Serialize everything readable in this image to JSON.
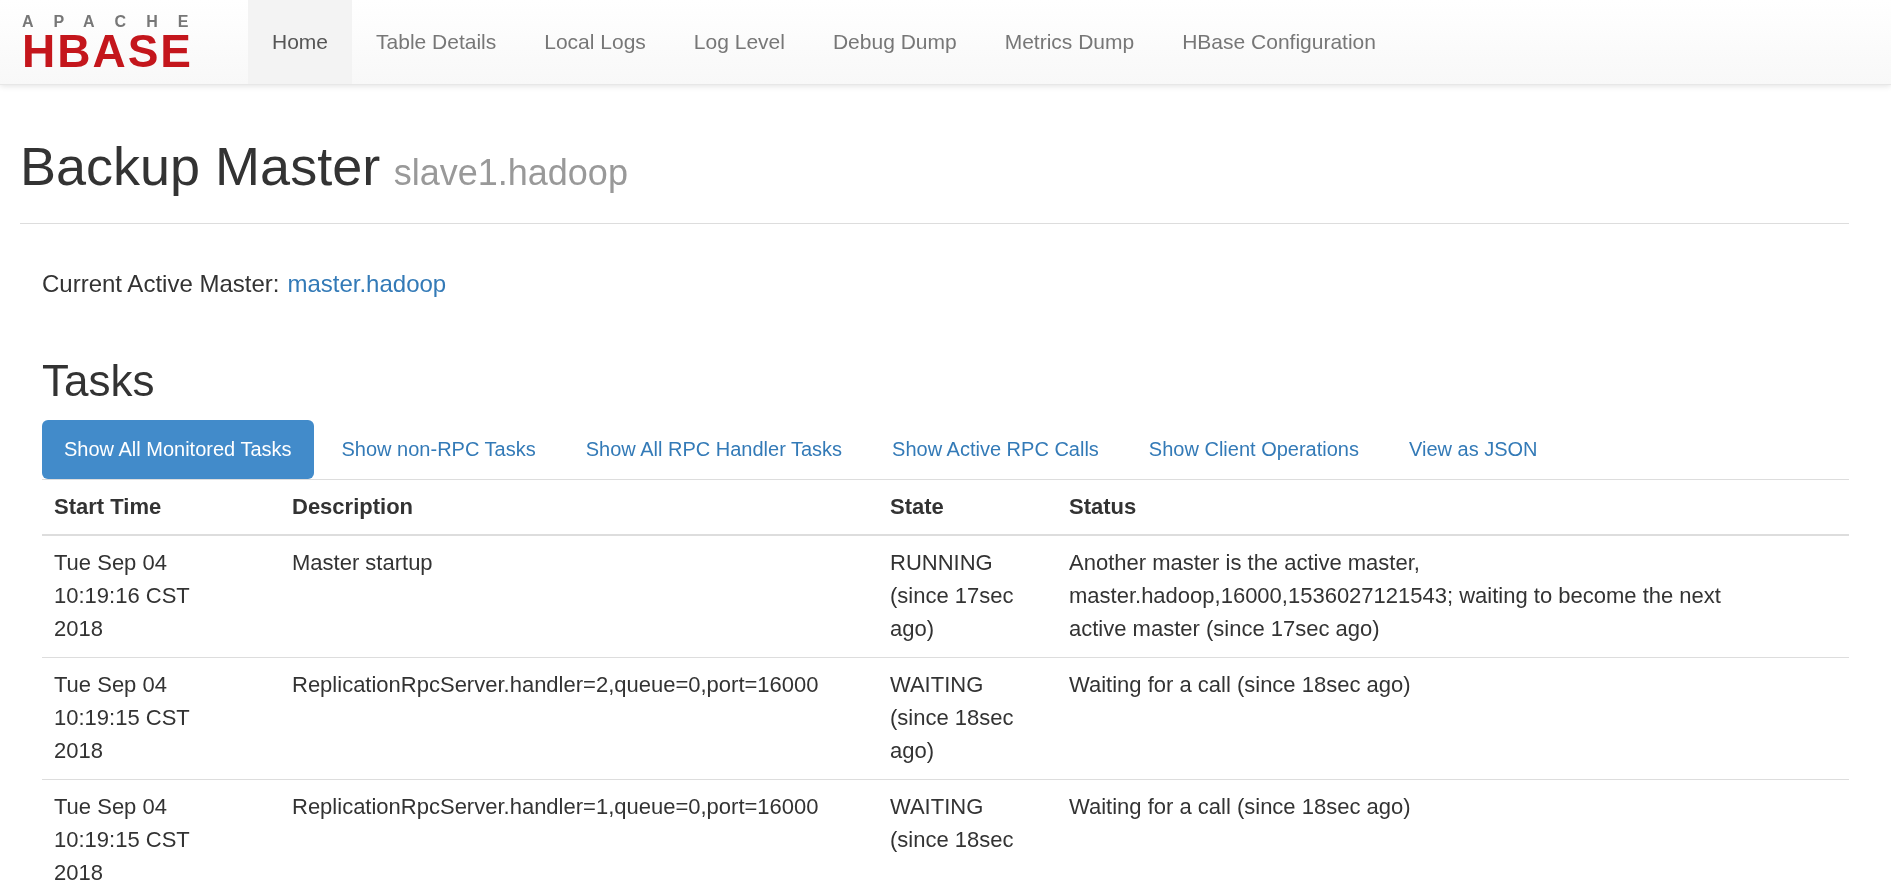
{
  "logo": {
    "top": "APACHE",
    "bottom": "HBASE"
  },
  "nav": [
    {
      "label": "Home",
      "selected": true
    },
    {
      "label": "Table Details",
      "selected": false
    },
    {
      "label": "Local Logs",
      "selected": false
    },
    {
      "label": "Log Level",
      "selected": false
    },
    {
      "label": "Debug Dump",
      "selected": false
    },
    {
      "label": "Metrics Dump",
      "selected": false
    },
    {
      "label": "HBase Configuration",
      "selected": false
    }
  ],
  "page_header": {
    "title": "Backup Master",
    "subtitle": "slave1.hadoop"
  },
  "active_master": {
    "label": "Current Active Master:",
    "link": "master.hadoop"
  },
  "tasks": {
    "title": "Tasks",
    "filters": [
      {
        "label": "Show All Monitored Tasks",
        "selected": true
      },
      {
        "label": "Show non-RPC Tasks",
        "selected": false
      },
      {
        "label": "Show All RPC Handler Tasks",
        "selected": false
      },
      {
        "label": "Show Active RPC Calls",
        "selected": false
      },
      {
        "label": "Show Client Operations",
        "selected": false
      },
      {
        "label": "View as JSON",
        "selected": false
      }
    ],
    "columns": [
      "Start Time",
      "Description",
      "State",
      "Status"
    ],
    "rows": [
      [
        "Tue Sep 04 10:19:16 CST 2018",
        "Master startup",
        "RUNNING (since 17sec ago)",
        "Another master is the active master, master.hadoop,16000,1536027121543; waiting to become the next active master (since 17sec ago)"
      ],
      [
        "Tue Sep 04 10:19:15 CST 2018",
        "ReplicationRpcServer.handler=2,queue=0,port=16000",
        "WAITING (since 18sec ago)",
        "Waiting for a call (since 18sec ago)"
      ],
      [
        "Tue Sep 04 10:19:15 CST 2018",
        "ReplicationRpcServer.handler=1,queue=0,port=16000",
        "WAITING (since 18sec",
        "Waiting for a call (since 18sec ago)"
      ]
    ]
  }
}
